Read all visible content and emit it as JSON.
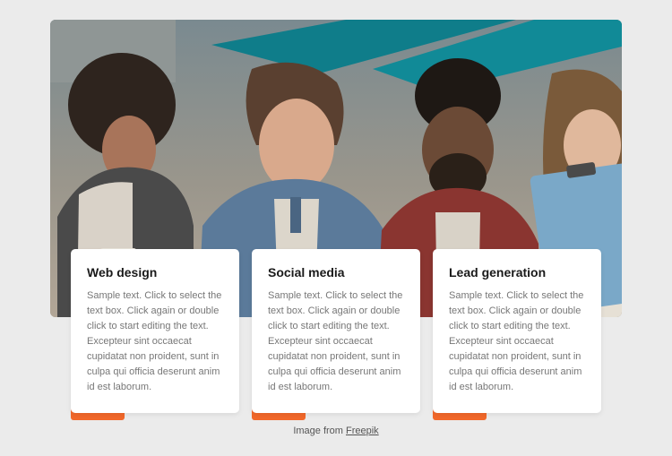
{
  "cards": [
    {
      "title": "Web design",
      "body": "Sample text. Click to select the text box. Click again or double click to start editing the text. Excepteur sint occaecat cupidatat non proident, sunt in culpa qui officia deserunt anim id est laborum."
    },
    {
      "title": "Social media",
      "body": "Sample text. Click to select the text box. Click again or double click to start editing the text. Excepteur sint occaecat cupidatat non proident, sunt in culpa qui officia deserunt anim id est laborum."
    },
    {
      "title": "Lead generation",
      "body": "Sample text. Click to select the text box. Click again or double click to start editing the text. Excepteur sint occaecat cupidatat non proident, sunt in culpa qui officia deserunt anim id est laborum."
    }
  ],
  "attribution": {
    "prefix": "Image from ",
    "link_text": "Freepik"
  }
}
